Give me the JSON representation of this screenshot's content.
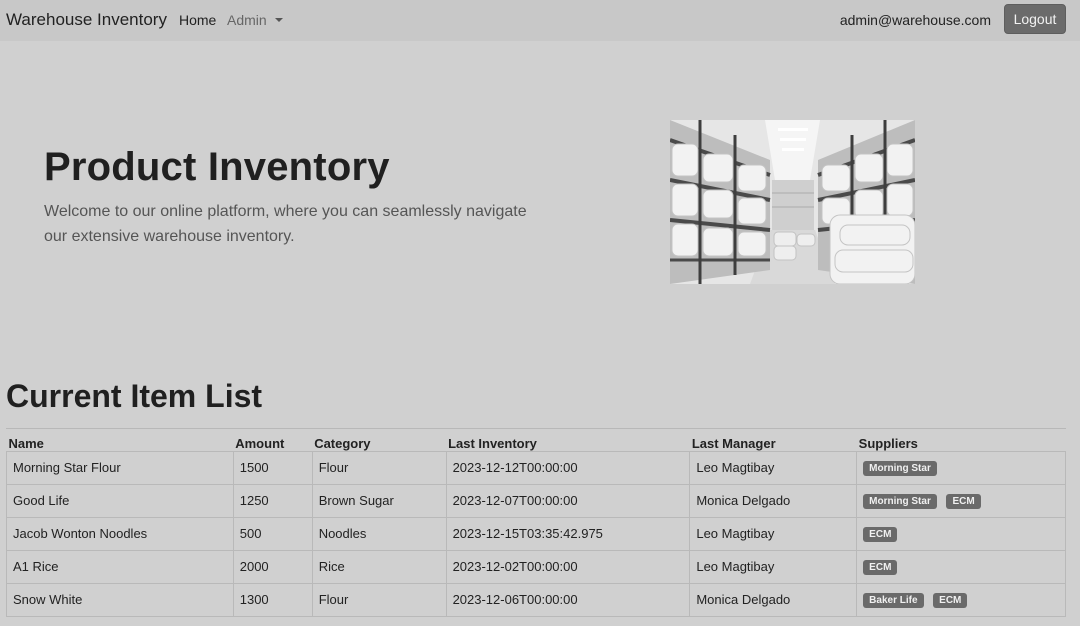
{
  "navbar": {
    "brand": "Warehouse Inventory",
    "home": "Home",
    "admin": "Admin",
    "user_email": "admin@warehouse.com",
    "logout": "Logout"
  },
  "hero": {
    "title": "Product Inventory",
    "text": "Welcome to our online platform, where you can seamlessly navigate our extensive warehouse inventory."
  },
  "list": {
    "title": "Current Item List",
    "columns": [
      "Name",
      "Amount",
      "Category",
      "Last Inventory",
      "Last Manager",
      "Suppliers"
    ],
    "rows": [
      {
        "name": "Morning Star Flour",
        "amount": "1500",
        "category": "Flour",
        "last_inventory": "2023-12-12T00:00:00",
        "last_manager": "Leo Magtibay",
        "suppliers": [
          "Morning Star"
        ]
      },
      {
        "name": "Good Life",
        "amount": "1250",
        "category": "Brown Sugar",
        "last_inventory": "2023-12-07T00:00:00",
        "last_manager": "Monica Delgado",
        "suppliers": [
          "Morning Star",
          "ECM"
        ]
      },
      {
        "name": "Jacob Wonton Noodles",
        "amount": "500",
        "category": "Noodles",
        "last_inventory": "2023-12-15T03:35:42.975",
        "last_manager": "Leo Magtibay",
        "suppliers": [
          "ECM"
        ]
      },
      {
        "name": "A1 Rice",
        "amount": "2000",
        "category": "Rice",
        "last_inventory": "2023-12-02T00:00:00",
        "last_manager": "Leo Magtibay",
        "suppliers": [
          "ECM"
        ]
      },
      {
        "name": "Snow White",
        "amount": "1300",
        "category": "Flour",
        "last_inventory": "2023-12-06T00:00:00",
        "last_manager": "Monica Delgado",
        "suppliers": [
          "Baker Life",
          "ECM"
        ]
      }
    ]
  }
}
